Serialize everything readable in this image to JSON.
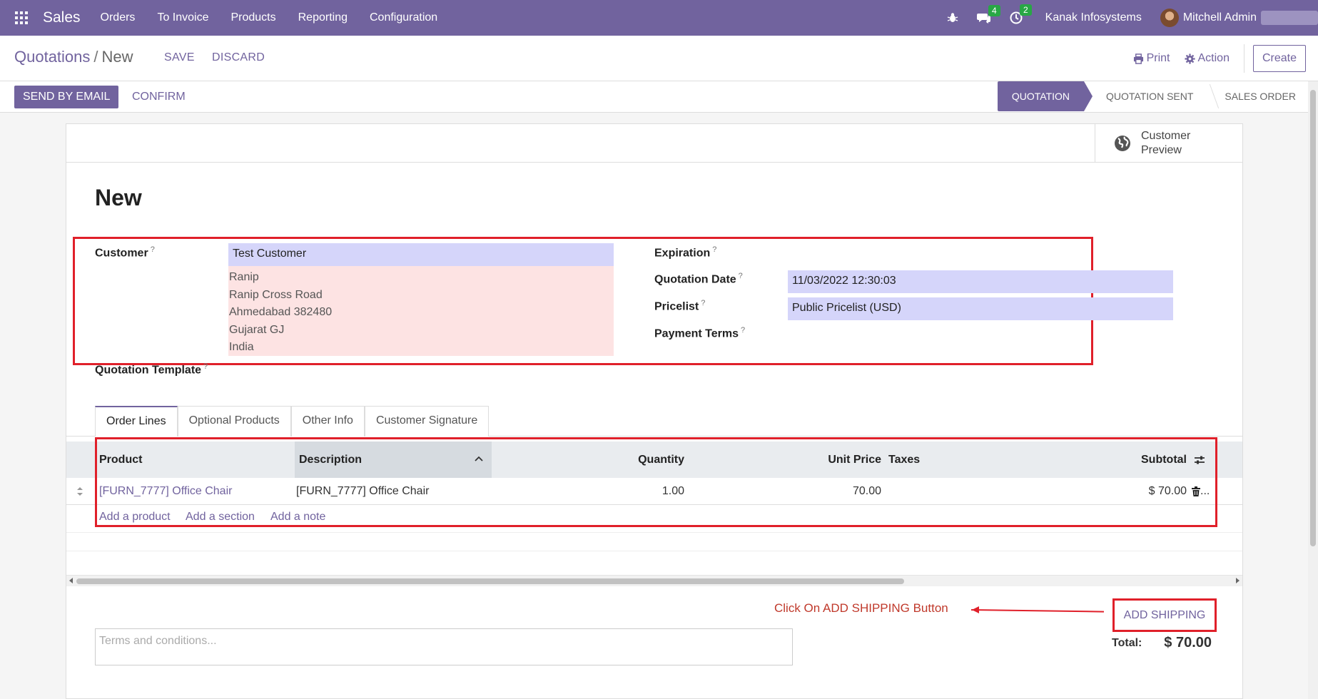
{
  "navbar": {
    "app_name": "Sales",
    "menu": [
      "Orders",
      "To Invoice",
      "Products",
      "Reporting",
      "Configuration"
    ],
    "messages_count": "4",
    "activities_count": "2",
    "company": "Kanak Infosystems",
    "user": "Mitchell Admin"
  },
  "control_panel": {
    "breadcrumb_parent": "Quotations",
    "breadcrumb_sep": "/",
    "breadcrumb_current": "New",
    "save_label": "SAVE",
    "discard_label": "DISCARD",
    "print_label": "Print",
    "action_label": "Action",
    "create_label": "Create"
  },
  "status_bar": {
    "send_email_label": "SEND BY EMAIL",
    "confirm_label": "CONFIRM",
    "stages": [
      "QUOTATION",
      "QUOTATION SENT",
      "SALES ORDER"
    ],
    "active_stage": "QUOTATION"
  },
  "sheet": {
    "preview_line1": "Customer",
    "preview_line2": "Preview",
    "title": "New",
    "customer_label": "Customer",
    "customer_value": "Test Customer",
    "address": [
      "Ranip",
      "Ranip Cross Road",
      "Ahmedabad 382480",
      "Gujarat GJ",
      "India"
    ],
    "template_label": "Quotation Template",
    "expiration_label": "Expiration",
    "quotation_date_label": "Quotation Date",
    "quotation_date_value": "11/03/2022 12:30:03",
    "pricelist_label": "Pricelist",
    "pricelist_value": "Public Pricelist (USD)",
    "payment_terms_label": "Payment Terms",
    "help_mark": "?"
  },
  "tabs": [
    "Order Lines",
    "Optional Products",
    "Other Info",
    "Customer Signature"
  ],
  "order_lines": {
    "headers": {
      "product": "Product",
      "description": "Description",
      "quantity": "Quantity",
      "unit_price": "Unit Price",
      "taxes": "Taxes",
      "subtotal": "Subtotal"
    },
    "rows": [
      {
        "product": "[FURN_7777] Office Chair",
        "description": "[FURN_7777] Office Chair",
        "quantity": "1.00",
        "unit_price": "70.00",
        "taxes": "",
        "subtotal": "$ 70.00",
        "more": "..."
      }
    ],
    "add_product": "Add a product",
    "add_section": "Add a section",
    "add_note": "Add a note"
  },
  "footer": {
    "annotation": "Click On ADD SHIPPING Button",
    "add_shipping_label": "ADD SHIPPING",
    "terms_placeholder": "Terms and conditions...",
    "total_label": "Total:",
    "total_value": "$ 70.00"
  },
  "colors": {
    "brand": "#71639e",
    "highlight_red": "#e0202a",
    "input_required": "#d5d5fa",
    "address_bg": "#fde3e3"
  }
}
